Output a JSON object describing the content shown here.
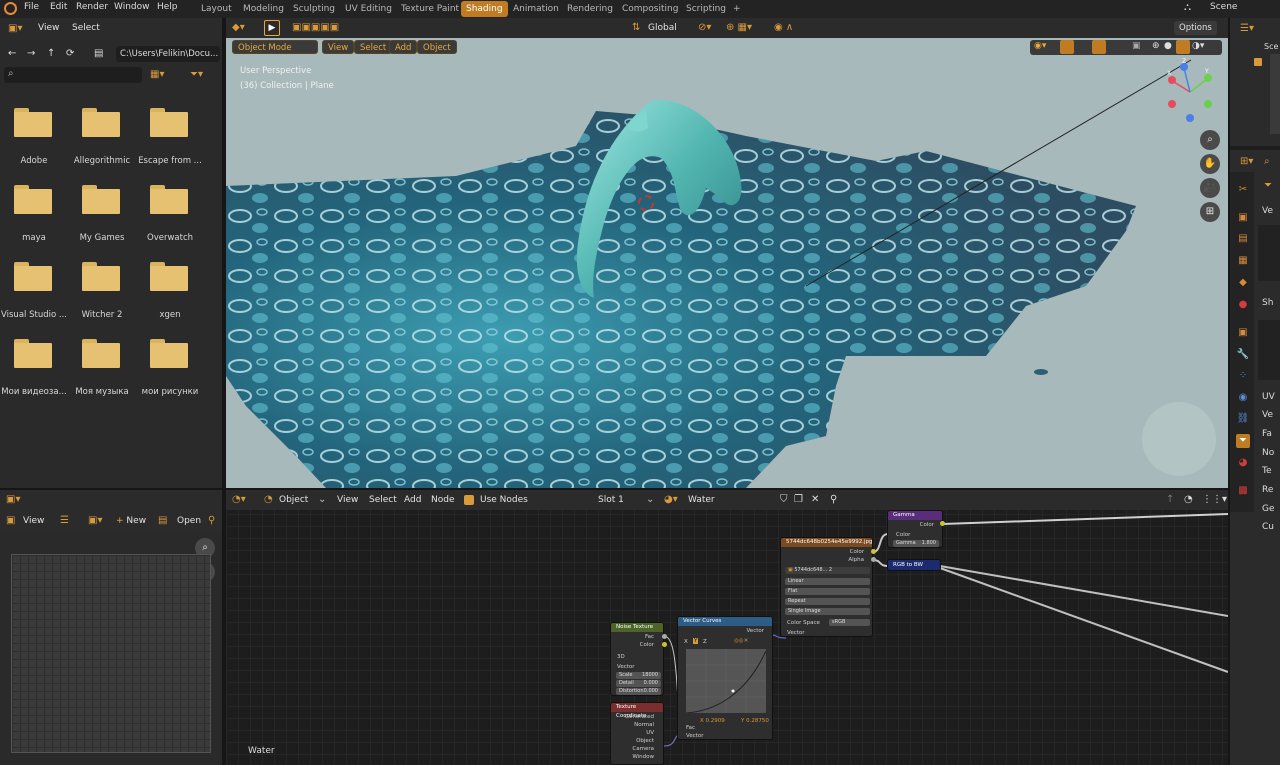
{
  "menu": {
    "items": [
      "File",
      "Edit",
      "Render",
      "Window",
      "Help"
    ]
  },
  "workspaces": {
    "tabs": [
      "Layout",
      "Modeling",
      "Sculpting",
      "UV Editing",
      "Texture Paint",
      "Shading",
      "Animation",
      "Rendering",
      "Compositing",
      "Scripting"
    ],
    "active": "Shading",
    "add": "+"
  },
  "scene": {
    "label": "Scene"
  },
  "file_browser": {
    "menus": [
      "View",
      "Select"
    ],
    "path": "C:\\Users\\Felikin\\Docu...",
    "folders": [
      "Adobe",
      "Allegorithmic",
      "Escape from ...",
      "maya",
      "My Games",
      "Overwatch",
      "Visual Studio ...",
      "Witcher 2",
      "xgen",
      "Мои видеоза...",
      "Моя музыка",
      "мои рисунки"
    ]
  },
  "viewport": {
    "transform_orientation": "Global",
    "options": "Options",
    "mode": "Object Mode",
    "menus": [
      "View",
      "Select",
      "Add",
      "Object"
    ],
    "overlay_line1": "User Perspective",
    "overlay_line2": "(36) Collection | Plane",
    "gizmo": {
      "x": "X",
      "y": "Y",
      "z": "Z"
    }
  },
  "image_editor": {
    "menus": [
      "View"
    ],
    "new": "New",
    "open": "Open"
  },
  "node_editor": {
    "object_label": "Object",
    "menus": [
      "View",
      "Select",
      "Add",
      "Node"
    ],
    "use_nodes": "Use Nodes",
    "slot": "Slot 1",
    "material": "Water",
    "footer_label": "Water"
  },
  "nodes": {
    "noise": {
      "title": "Noise Texture",
      "out_fac": "Fac",
      "out_color": "Color",
      "dim": "3D",
      "vector": "Vector",
      "scale": "Scale",
      "scale_val": "18000",
      "detail": "Detail",
      "detail_val": "0.000",
      "distortion": "Distortion",
      "distortion_val": "0.000"
    },
    "texcoord": {
      "title": "Texture Coordinate",
      "outs": [
        "Generated",
        "Normal",
        "UV",
        "Object",
        "Camera",
        "Window"
      ]
    },
    "curves": {
      "title": "Vector Curves",
      "out": "Vector",
      "axes": [
        "X",
        "Y",
        "Z"
      ],
      "x_val": "X 0.2909",
      "y_val": "Y 0.28750",
      "fac": "Fac",
      "vector": "Vector"
    },
    "image": {
      "title": "5744dc648b0254e45e9992.jpg",
      "out_color": "Color",
      "out_alpha": "Alpha",
      "img_name": "5744dc648...",
      "users": "2",
      "interp": "Linear",
      "proj": "Flat",
      "ext": "Repeat",
      "source": "Single Image",
      "colorspace": "Color Space",
      "colorspace_val": "sRGB",
      "vector": "Vector"
    },
    "gamma": {
      "title": "Gamma",
      "out": "Color",
      "in_color": "Color",
      "gamma": "Gamma",
      "gamma_val": "1.800"
    },
    "rgbbw": {
      "title": "RGB to BW"
    }
  },
  "properties": {
    "rows": [
      "Ve",
      "Sh",
      "UV",
      "Ve",
      "Fa",
      "No",
      "Te",
      "Re",
      "Ge",
      "Cu"
    ],
    "scene": "Sce"
  },
  "colors": {
    "accent": "#bf7c23",
    "x_axis": "#e84a5f",
    "y_axis": "#6bd14a",
    "z_axis": "#4a7fe8"
  },
  "icons": [
    "blender-logo-icon",
    "search-icon",
    "filter-icon",
    "arrow-left-icon",
    "arrow-right-icon",
    "parent-dir-icon",
    "refresh-icon",
    "new-folder-icon",
    "zoom-icon",
    "hand-icon",
    "camera-icon",
    "grid-icon",
    "pin-icon",
    "shield-icon",
    "close-icon"
  ]
}
